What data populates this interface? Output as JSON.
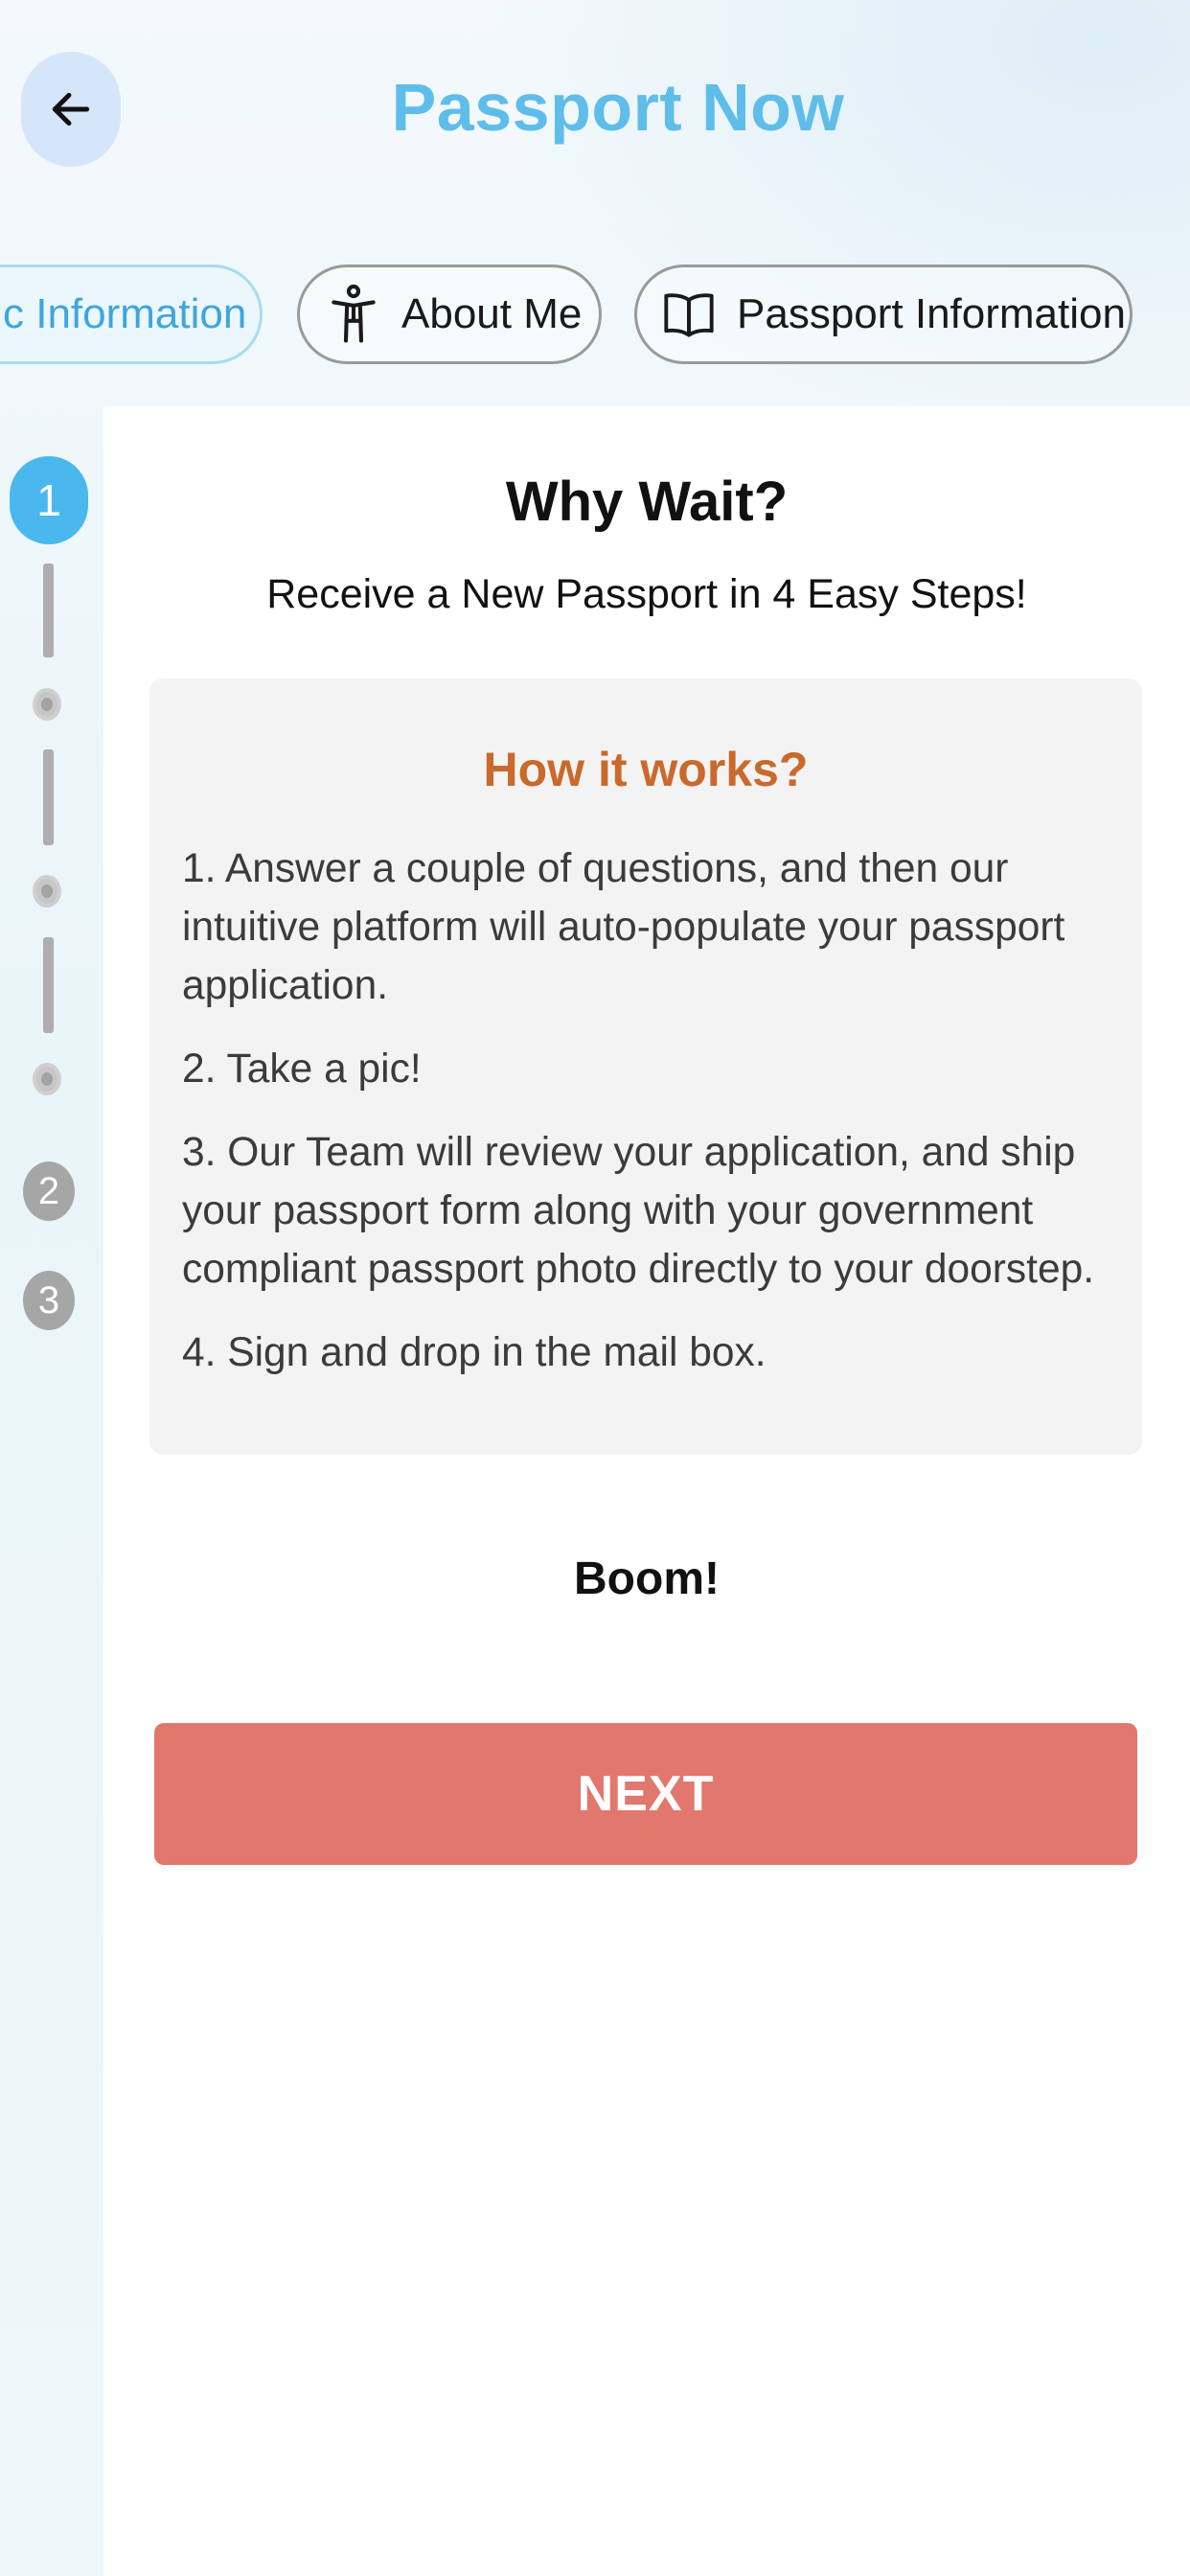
{
  "app": {
    "title": "Passport Now"
  },
  "header": {
    "back_icon": "arrow-left-icon"
  },
  "tabs": [
    {
      "label": "c Information",
      "active": true
    },
    {
      "label": "About Me",
      "icon": "accessibility-person-icon",
      "active": false
    },
    {
      "label": "Passport Information",
      "icon": "open-book-icon",
      "active": false
    }
  ],
  "stepper": {
    "active_step": "1",
    "upcoming_steps": [
      "2",
      "3"
    ]
  },
  "main": {
    "heading": "Why Wait?",
    "subheading": "Receive a New Passport in 4 Easy Steps!",
    "how_it_works": {
      "title": "How it works?",
      "steps": [
        "1. Answer a couple of questions, and then our intuitive platform will auto-populate your passport application.",
        "2. Take a pic!",
        "3. Our Team will review your application, and ship your passport form along with your government compliant passport photo directly to your doorstep.",
        "4. Sign and drop in the mail box."
      ]
    },
    "closing": "Boom!",
    "next_label": "NEXT"
  },
  "colors": {
    "brand_blue": "#5fbde9",
    "active_step_blue": "#4ab8ee",
    "accent_orange": "#c96a2c",
    "button_coral": "#e2776d"
  }
}
